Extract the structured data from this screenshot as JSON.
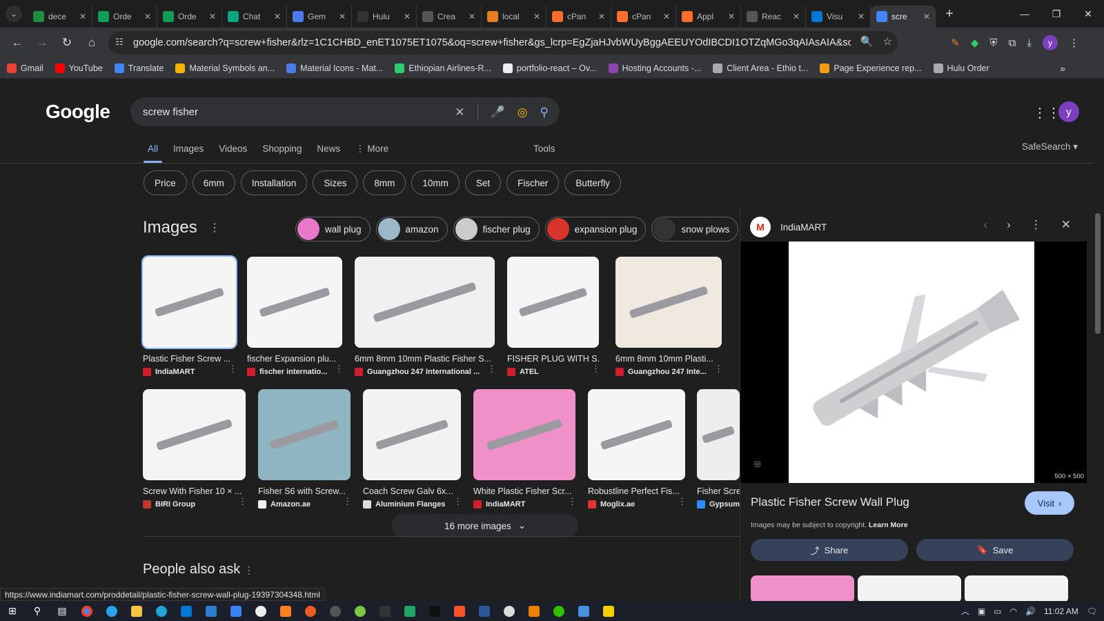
{
  "tabs": [
    {
      "title": "dece",
      "color": "#1e8e3e",
      "active": false
    },
    {
      "title": "Orde",
      "color": "#0f9d58",
      "active": false
    },
    {
      "title": "Orde",
      "color": "#0f9d58",
      "active": false
    },
    {
      "title": "Chat",
      "color": "#10a37f",
      "active": false
    },
    {
      "title": "Gem",
      "color": "#4b7bec",
      "active": false
    },
    {
      "title": "Hulu",
      "color": "#333",
      "active": false
    },
    {
      "title": "Crea",
      "color": "#555",
      "active": false
    },
    {
      "title": "local",
      "color": "#e67e22",
      "active": false
    },
    {
      "title": "cPan",
      "color": "#ff6c2c",
      "active": false
    },
    {
      "title": "cPan",
      "color": "#ff6c2c",
      "active": false
    },
    {
      "title": "Appl",
      "color": "#ff6c2c",
      "active": false
    },
    {
      "title": "Reac",
      "color": "#555",
      "active": false
    },
    {
      "title": "Visu",
      "color": "#0078d4",
      "active": false
    },
    {
      "title": "scre",
      "color": "#4285f4",
      "active": true
    }
  ],
  "url": "google.com/search?q=screw+fisher&rlz=1C1CHBD_enET1075ET1075&oq=screw+fisher&gs_lcrp=EgZjaHJvbWUyBggAEEUYOdIBCDI1OTZqMGo3qAIAsAIA&sourceid=ch...",
  "profile_initial": "y",
  "bookmarks": [
    {
      "label": "Gmail",
      "color": "#ea4335"
    },
    {
      "label": "YouTube",
      "color": "#ff0000"
    },
    {
      "label": "Translate",
      "color": "#4285f4"
    },
    {
      "label": "Material Symbols an...",
      "color": "#f4b400"
    },
    {
      "label": "Material Icons - Mat...",
      "color": "#4b7bec"
    },
    {
      "label": "Ethiopian Airlines-R...",
      "color": "#2ecc71"
    },
    {
      "label": "portfolio-react – Ov...",
      "color": "#eee"
    },
    {
      "label": "Hosting Accounts -...",
      "color": "#8e44ad"
    },
    {
      "label": "Client Area - Ethio t...",
      "color": "#aaa"
    },
    {
      "label": "Page Experience rep...",
      "color": "#f39c12"
    },
    {
      "label": "Hulu Order",
      "color": "#aaa"
    }
  ],
  "google": {
    "logo": "Google",
    "query": "screw fisher",
    "nav": [
      "All",
      "Images",
      "Videos",
      "Shopping",
      "News",
      "⋮ More"
    ],
    "tools": "Tools",
    "safesearch": "SafeSearch ▾",
    "chips": [
      "Price",
      "6mm",
      "Installation",
      "Sizes",
      "8mm",
      "10mm",
      "Set",
      "Fischer",
      "Butterfly"
    ],
    "images_heading": "Images",
    "related_chips": [
      {
        "label": "wall plug",
        "color": "#e879c8"
      },
      {
        "label": "amazon",
        "color": "#9db6c8"
      },
      {
        "label": "fischer plug",
        "color": "#ccc"
      },
      {
        "label": "expansion plug",
        "color": "#d9342b"
      },
      {
        "label": "snow plows",
        "color": "#333"
      }
    ],
    "results_row1": [
      {
        "caption": "Plastic Fisher Screw ...",
        "source": "IndiaMART",
        "icon": "#d21e2b",
        "bg": "#f5f5f5"
      },
      {
        "caption": "fischer Expansion plu...",
        "source": "fischer internatio...",
        "icon": "#d21e2b",
        "bg": "#f5f5f5"
      },
      {
        "caption": "6mm 8mm 10mm Plastic Fisher S...",
        "source": "Guangzhou 247 International ...",
        "icon": "#d21e2b",
        "bg": "#f0f0f0"
      },
      {
        "caption": "FISHER PLUG WITH S...",
        "source": "ATEL",
        "icon": "#d21e2b",
        "bg": "#f5f5f5"
      },
      {
        "caption": "6mm 8mm 10mm Plasti...",
        "source": "Guangzhou 247 Inte...",
        "icon": "#d21e2b",
        "bg": "#efe9df"
      }
    ],
    "results_row2": [
      {
        "caption": "Screw With Fisher 10 × ...",
        "source": "BIRI Group",
        "icon": "#c0392b",
        "bg": "#f4f4f4"
      },
      {
        "caption": "Fisher S6 with Screw...",
        "source": "Amazon.ae",
        "icon": "#eee",
        "bg": "#8fb4c2"
      },
      {
        "caption": "Coach Screw Galv 6x...",
        "source": "Aluminium Flanges",
        "icon": "#ddd",
        "bg": "#f2f2f2"
      },
      {
        "caption": "White Plastic Fisher Scr...",
        "source": "IndiaMART",
        "icon": "#d21e2b",
        "bg": "#f090c8"
      },
      {
        "caption": "Robustline Perfect Fis...",
        "source": "Moglix.ae",
        "icon": "#e3342f",
        "bg": "#f5f5f5"
      },
      {
        "caption": "Fisher Scre",
        "source": "Gypsum",
        "icon": "#2d8cff",
        "bg": "#eeeeee"
      }
    ],
    "more_images": "16 more images",
    "paa": "People also ask"
  },
  "panel": {
    "source": "IndiaMART",
    "dims": "500 × 500",
    "title": "Plastic Fisher Screw Wall Plug",
    "visit": "Visit",
    "copyright": "Images may be subject to copyright.",
    "learn_more": "Learn More",
    "share": "Share",
    "save": "Save"
  },
  "status_url": "https://www.indiamart.com/proddetail/plastic-fisher-screw-wall-plug-19397304348.html",
  "taskbar": {
    "time": "11:02 AM"
  }
}
